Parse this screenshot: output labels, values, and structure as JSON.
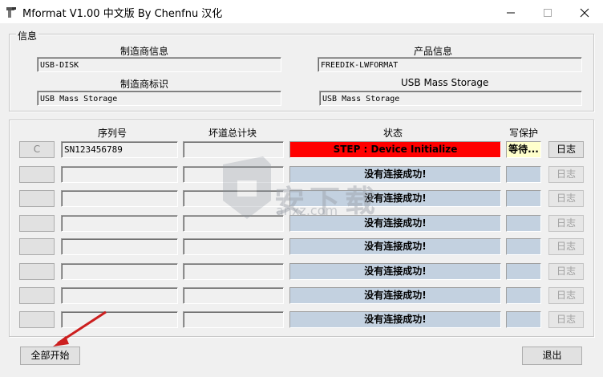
{
  "window": {
    "title": "Mformat V1.00 中文版 By Chenfnu 汉化",
    "controls": [
      "minimize-icon",
      "maximize-icon",
      "close-icon"
    ]
  },
  "info": {
    "group_label": "信息",
    "manufacturer_info_label": "制造商信息",
    "manufacturer_info_value": "USB-DISK",
    "product_info_label": "产品信息",
    "product_info_value": "FREEDIK-LWFORMAT",
    "manufacturer_id_label": "制造商标识",
    "manufacturer_id_value": "USB Mass Storage",
    "product_id_label": "产品标识",
    "product_id_value": "USB Mass Storage"
  },
  "devices": {
    "headers": {
      "serial": "序列号",
      "bad_blocks": "坏道总计块",
      "status": "状态",
      "write_protect": "写保护"
    },
    "log_label": "日志",
    "rows": [
      {
        "button": "C",
        "serial": "SN123456789",
        "bad_blocks": "",
        "status": "STEP : Device Initialize",
        "status_state": "error",
        "write_protect": "等待...",
        "log_enabled": true
      },
      {
        "button": "",
        "serial": "",
        "bad_blocks": "",
        "status": "没有连接成功!",
        "status_state": "idle",
        "write_protect": "",
        "log_enabled": false
      },
      {
        "button": "",
        "serial": "",
        "bad_blocks": "",
        "status": "没有连接成功!",
        "status_state": "idle",
        "write_protect": "",
        "log_enabled": false
      },
      {
        "button": "",
        "serial": "",
        "bad_blocks": "",
        "status": "没有连接成功!",
        "status_state": "idle",
        "write_protect": "",
        "log_enabled": false
      },
      {
        "button": "",
        "serial": "",
        "bad_blocks": "",
        "status": "没有连接成功!",
        "status_state": "idle",
        "write_protect": "",
        "log_enabled": false
      },
      {
        "button": "",
        "serial": "",
        "bad_blocks": "",
        "status": "没有连接成功!",
        "status_state": "idle",
        "write_protect": "",
        "log_enabled": false
      },
      {
        "button": "",
        "serial": "",
        "bad_blocks": "",
        "status": "没有连接成功!",
        "status_state": "idle",
        "write_protect": "",
        "log_enabled": false
      },
      {
        "button": "",
        "serial": "",
        "bad_blocks": "",
        "status": "没有连接成功!",
        "status_state": "idle",
        "write_protect": "",
        "log_enabled": false
      }
    ]
  },
  "footer": {
    "start_all_label": "全部开始",
    "exit_label": "退出"
  },
  "watermark": {
    "text": "安下载",
    "sub": "anxz.com"
  },
  "colors": {
    "status_error": "#ff0000",
    "status_idle": "#c3d1e0",
    "annotation_arrow": "#cc1f1f"
  }
}
